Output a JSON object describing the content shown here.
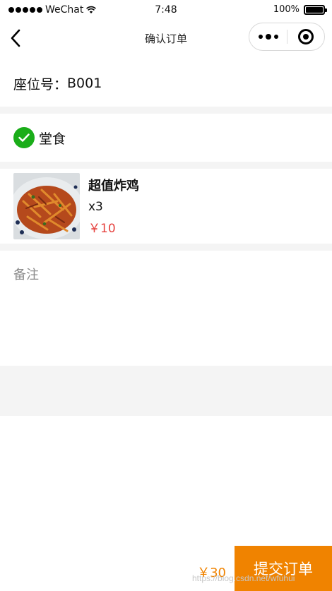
{
  "status_bar": {
    "carrier": "WeChat",
    "time": "7:48",
    "battery_percent": "100%",
    "battery_level": 1.0
  },
  "nav": {
    "title": "确认订单"
  },
  "order": {
    "seat_label": "座位号：",
    "seat_value": "B001",
    "dine_type": "堂食",
    "items": [
      {
        "name": "超值炸鸡",
        "quantity": "x3",
        "price": "￥10"
      }
    ],
    "note_placeholder": "备注",
    "total": "￥30",
    "submit_label": "提交订单"
  },
  "watermark": "https://blog.csdn.net/wfuhui",
  "colors": {
    "accent": "#f08300",
    "check_green": "#1aad19",
    "price_red": "#e64340",
    "section_gap": "#f4f4f4"
  }
}
